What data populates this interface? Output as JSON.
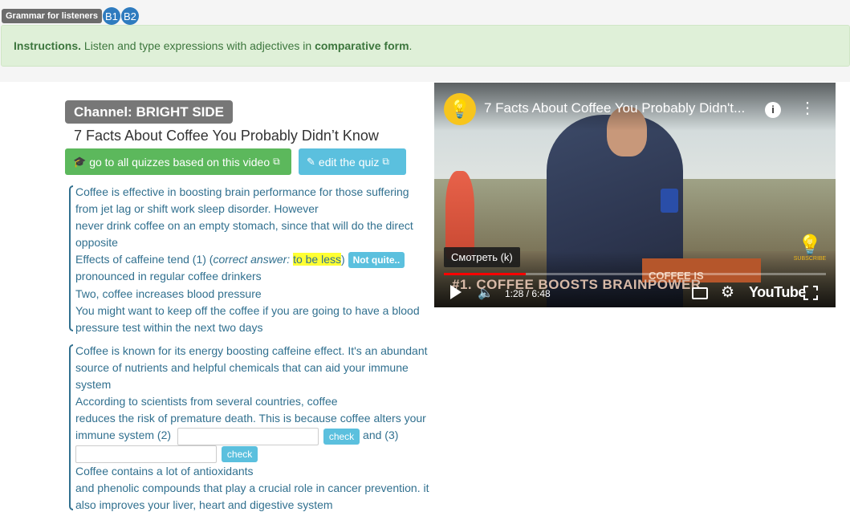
{
  "header": {
    "category": "Grammar for listeners",
    "levels": [
      "B1",
      "B2"
    ]
  },
  "instructions": {
    "prefix": "Instructions.",
    "text_before": " Listen and type expressions with adjectives in ",
    "emphasis": "comparative form",
    "text_after": "."
  },
  "channel": "Channel: BRIGHT SIDE",
  "video_title": "7 Facts About Coffee You Probably Didn’t Know",
  "buttons": {
    "all_quizzes": "go to all quizzes based on this video",
    "edit_quiz": "edit the quiz"
  },
  "block1": {
    "line1": "Coffee is effective in boosting brain performance for those suffering",
    "line2": "from jet lag or shift work sleep disorder. However",
    "line3": "never drink coffee on an empty stomach, since that will do the direct",
    "line4": "opposite",
    "line5_before": "Effects of caffeine tend (1)  (",
    "correct_label": "correct answer:",
    "correct_answer": "to be less",
    "line5_after": ")",
    "feedback": "Not quite..",
    "line6": "pronounced in regular coffee drinkers",
    "line7": "Two, coffee increases blood pressure",
    "line8": "You might want to keep off the coffee if you are going to have a blood",
    "line9": "pressure test within the next two days"
  },
  "block2": {
    "line1": "Coffee is known for its energy boosting caffeine effect. It's an abundant",
    "line2": "source of nutrients and helpful chemicals that can aid your immune",
    "line3": "system",
    "line4": "According to scientists from several countries, coffee",
    "line5": "reduces the risk of premature death. This is because coffee alters your",
    "line6": "immune system (2)",
    "check_label": "check",
    "and3": " and (3)",
    "line8": "Coffee contains a lot of antioxidants",
    "line9": "and phenolic compounds that play a crucial role in cancer prevention. it",
    "line10": "also improves your liver, heart and digestive system"
  },
  "player": {
    "title": "7 Facts About Coffee You Probably Didn't...",
    "info": "i",
    "tooltip": "Смотреть (k)",
    "chapter": "#1. COFFEE BOOSTS BRAINPOWER",
    "banner": "COFFEE IS EFFECTIVE",
    "subscribe": "SUBSCRIBE",
    "time": "1:28 / 6:48",
    "progress": 0.215,
    "brand": "YouTube"
  }
}
